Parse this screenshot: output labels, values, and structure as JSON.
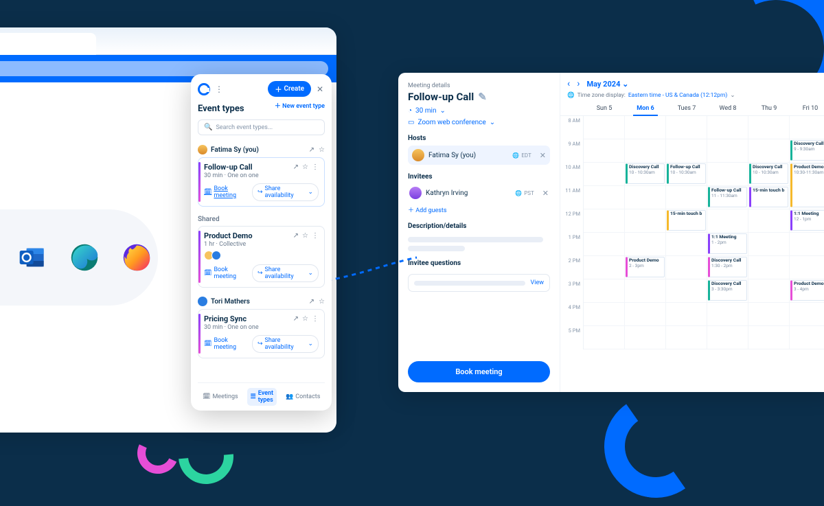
{
  "extension": {
    "create_label": "Create",
    "heading": "Event types",
    "new_event_type_label": "New event type",
    "search_placeholder": "Search event types...",
    "owners": [
      {
        "name": "Fatima Sy (you)"
      },
      {
        "name": "Shared"
      },
      {
        "name": "Tori Mathers"
      }
    ],
    "cards": {
      "followup": {
        "title": "Follow-up Call",
        "subtitle": "30 min · One on one",
        "book": "Book meeting",
        "share": "Share availability"
      },
      "demo": {
        "title": "Product Demo",
        "subtitle": "1 hr · Collective",
        "book": "Book meeting",
        "share": "Share availability"
      },
      "pricing": {
        "title": "Pricing Sync",
        "subtitle": "30 min · One on one",
        "book": "Book meeting",
        "share": "Share availability"
      }
    },
    "nav": {
      "meetings": "Meetings",
      "event_types": "Event types",
      "contacts": "Contacts"
    }
  },
  "details": {
    "heading_small": "Meeting details",
    "title": "Follow-up Call",
    "duration": "30 min",
    "location": "Zoom web conference",
    "hosts_label": "Hosts",
    "host": {
      "name": "Fatima Sy (you)",
      "tz": "EDT"
    },
    "invitees_label": "Invitees",
    "invitee": {
      "name": "Kathryn Irving",
      "tz": "PST"
    },
    "add_guests": "Add guests",
    "desc_label": "Description/details",
    "questions_label": "Invitee questions",
    "view": "View",
    "book_button": "Book meeting"
  },
  "calendar": {
    "month": "May 2024",
    "tz_label": "Time zone display:",
    "tz_value": "Eastern time - US & Canada (12:12pm)",
    "days": [
      "Sun 5",
      "Mon 6",
      "Tues 7",
      "Wed 8",
      "Thu 9",
      "Fri 10"
    ],
    "today_index": 1,
    "hours": [
      "8 AM",
      "9 AM",
      "10 AM",
      "11 AM",
      "12 PM",
      "1 PM",
      "2 PM",
      "3 PM",
      "4 PM",
      "5 PM"
    ],
    "events": [
      {
        "day": 1,
        "start": 2,
        "len": 1,
        "color": "#17b39a",
        "title": "Discovery Call",
        "sub": "10 - 10:30am"
      },
      {
        "day": 2,
        "start": 2,
        "len": 1,
        "color": "#17b39a",
        "title": "Follow-up Call",
        "sub": "10 - 10:30am"
      },
      {
        "day": 4,
        "start": 2,
        "len": 1,
        "color": "#17b39a",
        "title": "Discovery Call",
        "sub": "10 - 10:30am"
      },
      {
        "day": 5,
        "start": 1,
        "len": 1,
        "color": "#17b39a",
        "title": "Discovery Call",
        "sub": "9 - 9:30am"
      },
      {
        "day": 5,
        "start": 2,
        "len": 2,
        "color": "#f5b92c",
        "title": "Product Demo",
        "sub": "10:30-11:30am"
      },
      {
        "day": 3,
        "start": 3,
        "len": 1,
        "color": "#17b39a",
        "title": "Follow-up Call",
        "sub": "11 - 11:30am"
      },
      {
        "day": 4,
        "start": 3,
        "len": 1,
        "color": "#8a3ffb",
        "title": "15-min touch b"
      },
      {
        "day": 2,
        "start": 4,
        "len": 1,
        "color": "#f5b92c",
        "title": "15-min touch b"
      },
      {
        "day": 5,
        "start": 4,
        "len": 1,
        "color": "#8a3ffb",
        "title": "1:1 Meeting",
        "sub": "12 - 1pm"
      },
      {
        "day": 3,
        "start": 5,
        "len": 1,
        "color": "#8a3ffb",
        "title": "1:1 Meeting",
        "sub": "1 - 2pm"
      },
      {
        "day": 3,
        "start": 6,
        "len": 1,
        "color": "#e64ed7",
        "title": "Discovery Call",
        "sub": "1:30 - 2pm"
      },
      {
        "day": 1,
        "start": 6,
        "len": 1,
        "color": "#e64ed7",
        "title": "Product Demo",
        "sub": "2 - 3pm"
      },
      {
        "day": 3,
        "start": 7,
        "len": 1,
        "color": "#17b39a",
        "title": "Discovery Call",
        "sub": "3 - 3:30pm"
      },
      {
        "day": 5,
        "start": 7,
        "len": 1,
        "color": "#e64ed7",
        "title": "Product Demo",
        "sub": "3 - 4pm"
      }
    ]
  }
}
